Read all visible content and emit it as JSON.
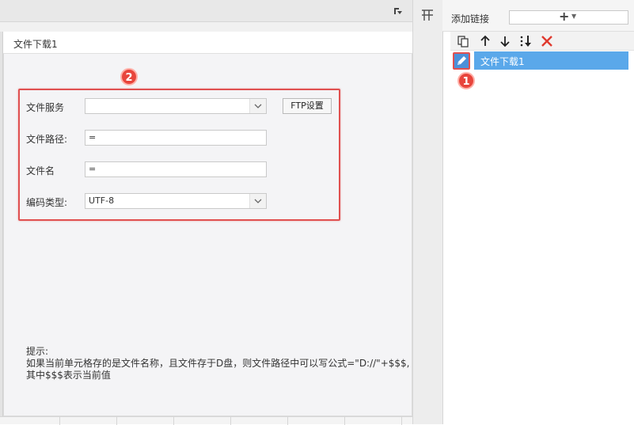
{
  "dialog": {
    "title": "文件下载1",
    "fields": {
      "file_service_label": "文件服务",
      "file_service_value": "",
      "ftp_button": "FTP设置",
      "file_path_label": "文件路径:",
      "file_path_value": "=",
      "file_name_label": "文件名",
      "file_name_value": "=",
      "encoding_label": "编码类型:",
      "encoding_value": "UTF-8"
    },
    "tip": "提示:\n如果当前单元格存的是文件名称，且文件存于D盘，则文件路径中可以写公式=\"D://\"+$$$,\n其中$$$表示当前值"
  },
  "badges": {
    "one": "1",
    "two": "2"
  },
  "right_panel": {
    "add_link_label": "添加链接",
    "add_symbol": "+",
    "items": [
      {
        "label": "文件下载1"
      }
    ]
  },
  "colors": {
    "accent": "#5aa8ea",
    "highlight": "#e05050",
    "badge": "#e8453c",
    "delete": "#e03a2f"
  },
  "icons": [
    "copy-icon",
    "move-up-icon",
    "move-down-icon",
    "sort-icon",
    "delete-icon",
    "edit-icon",
    "format-icon",
    "grid-icon"
  ]
}
